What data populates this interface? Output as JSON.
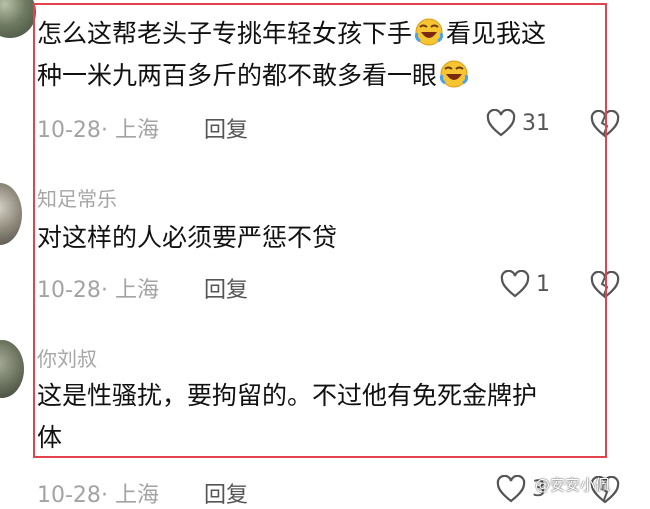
{
  "comments": [
    {
      "name": "",
      "line1": "怎么这帮老头子专挑年轻女孩下手",
      "line1_after": "看见我这",
      "line2": "种一米九两百多斤的都不敢多看一眼",
      "date": "10-28",
      "location": "上海",
      "reply_label": "回复",
      "likes": "31",
      "emoji_icon": "grinning-squinting-tears-emoji"
    },
    {
      "name": "知足常乐",
      "text": "对这样的人必须要严惩不贷",
      "date": "10-28",
      "location": "上海",
      "reply_label": "回复",
      "likes": "1"
    },
    {
      "name": "你刘叔",
      "line1": "这是性骚扰，要拘留的。不过他有免死金牌护",
      "line2": "体",
      "date": "10-28",
      "location": "上海",
      "reply_label": "回复",
      "likes": "3"
    }
  ],
  "watermark": "@安安小佩",
  "colors": {
    "highlight": "#e3434f",
    "meta": "#a3a3a3",
    "name": "#a6a6a6"
  }
}
